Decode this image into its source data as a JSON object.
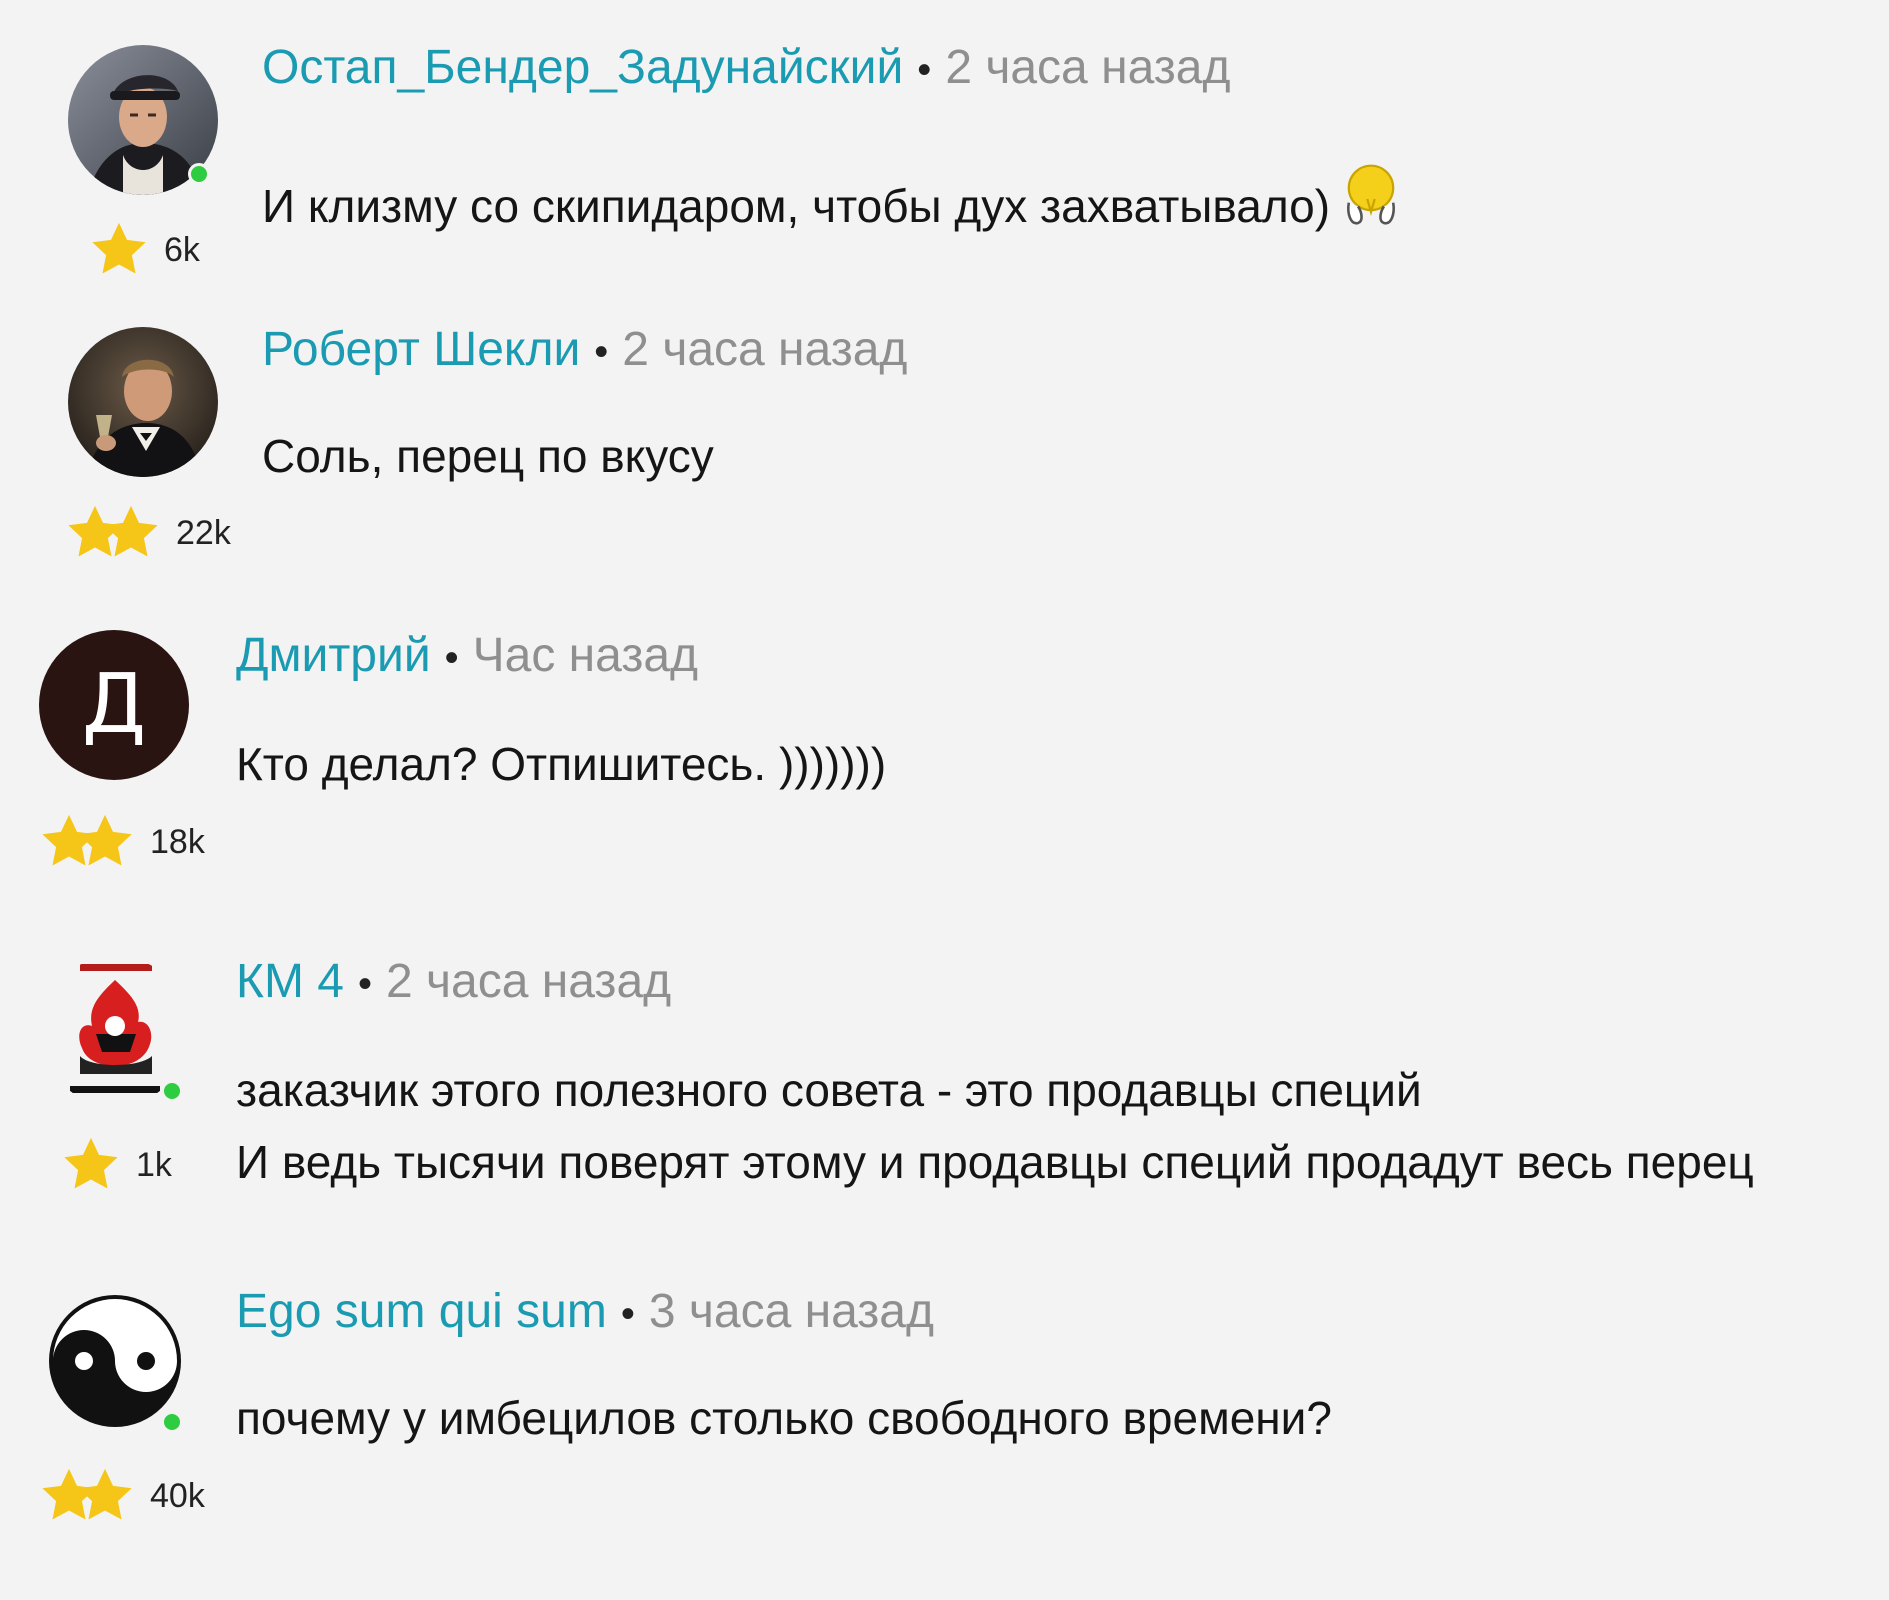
{
  "colors": {
    "background": "#f3f3f3",
    "author": "#1b9bb2",
    "time": "#8f8f8f",
    "text": "#151515",
    "online": "#2ecc40",
    "star": "#f5c518"
  },
  "comments": [
    {
      "author": "Остап_Бендер_Задунайский",
      "separator": "•",
      "time": "2 часа назад",
      "lines": [
        "И клизму со скипидаром, чтобы дух захватывало)"
      ],
      "emoji": "facepalm-emoji-icon",
      "rating": "6k",
      "stars": 1,
      "online": true,
      "avatar": "photo-man-in-cap"
    },
    {
      "author": "Роберт Шекли",
      "separator": "•",
      "time": "2 часа назад",
      "lines": [
        "Соль, перец по вкусу"
      ],
      "rating": "22k",
      "stars": 2,
      "online": false,
      "avatar": "photo-man-with-glass"
    },
    {
      "author": "Дмитрий",
      "separator": "•",
      "time": "Час назад",
      "lines": [
        "Кто делал? Отпишитесь. )))))))"
      ],
      "rating": "18k",
      "stars": 2,
      "online": false,
      "avatar_letter": "Д"
    },
    {
      "author": "КМ 4",
      "separator": "•",
      "time": "2 часа назад",
      "lines": [
        "заказчик этого полезного совета - это продавцы специй",
        "И ведь тысячи поверят этому и продавцы специй продадут весь перец"
      ],
      "rating": "1k",
      "stars": 1,
      "online": true,
      "avatar": "red-emblem-logo"
    },
    {
      "author": "Ego sum qui sum",
      "separator": "•",
      "time": "3 часа назад",
      "lines": [
        "почему у имбецилов столько свободного времени?"
      ],
      "rating": "40k",
      "stars": 2,
      "online": true,
      "avatar": "yin-yang-icon"
    }
  ]
}
